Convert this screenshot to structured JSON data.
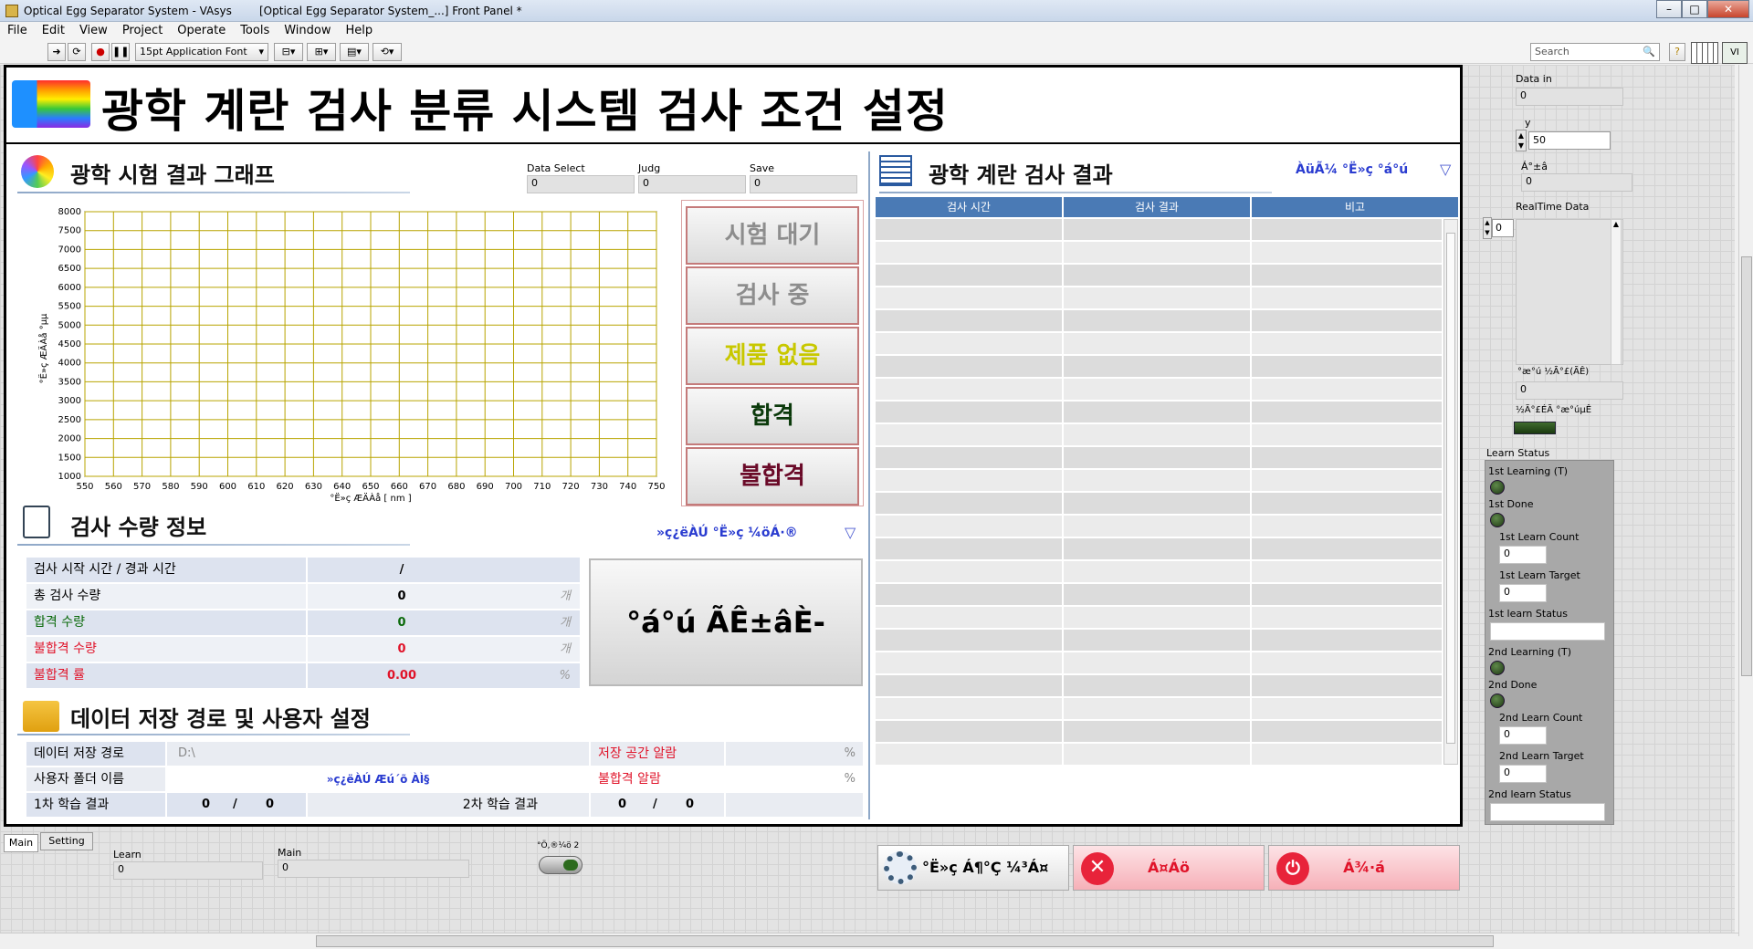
{
  "window": {
    "title": "Optical Egg Separator System - VAsys",
    "title2": "[Optical Egg Separator System_...] Front Panel *"
  },
  "menu": [
    "File",
    "Edit",
    "View",
    "Project",
    "Operate",
    "Tools",
    "Window",
    "Help"
  ],
  "toolbar": {
    "font": "15pt Application Font",
    "search_placeholder": "Search"
  },
  "panel": {
    "title": "광학 계란 검사 분류 시스템 검사 조건 설정"
  },
  "graph": {
    "header": "광학 시험 결과 그래프",
    "data_select_label": "Data Select",
    "data_select_value": "0",
    "judg_label": "Judg",
    "judg_value": "0",
    "save_label": "Save",
    "save_value": "0",
    "ylabel": "°Ë»ç ÆÄÀå °­µµ",
    "xlabel": "°Ë»ç ÆÄÀå [ nm ]"
  },
  "chart_data": {
    "type": "line",
    "x": [
      550,
      560,
      570,
      580,
      590,
      600,
      610,
      620,
      630,
      640,
      650,
      660,
      670,
      680,
      690,
      700,
      710,
      720,
      730,
      740,
      750
    ],
    "y_ticks": [
      8000,
      7500,
      7000,
      6500,
      6000,
      5500,
      5000,
      4500,
      4000,
      3500,
      3000,
      2500,
      2000,
      1500,
      1000
    ],
    "series": [],
    "xlabel": "°Ë»ç ÆÄÀå [ nm ]",
    "ylabel": "°Ë»ç ÆÄÀå °­µµ",
    "xlim": [
      550,
      750
    ],
    "ylim": [
      1000,
      8000
    ],
    "grid": true
  },
  "status_buttons": [
    {
      "label": "시험 대기",
      "color": "#8d8d8d"
    },
    {
      "label": "검사 중",
      "color": "#8d8d8d"
    },
    {
      "label": "제품 없음",
      "color": "#c8c800"
    },
    {
      "label": "합격",
      "color": "#0b3a0b"
    },
    {
      "label": "불합격",
      "color": "#6a0a28"
    }
  ],
  "qty": {
    "header": "검사 수량 정보",
    "dropdown": "»ç¿ëÀÚ °Ë»ç ¼öÁ·®",
    "rows": [
      {
        "label": "검사 시작 시간 / 경과 시간",
        "value": "/",
        "unit": "",
        "color": "#000"
      },
      {
        "label": "총 검사 수량",
        "value": "0",
        "unit": "개",
        "color": "#000"
      },
      {
        "label": "합격 수량",
        "value": "0",
        "unit": "개",
        "color": "#0b6a0b"
      },
      {
        "label": "불합격 수량",
        "value": "0",
        "unit": "개",
        "color": "#e0142a"
      },
      {
        "label": "불합격 률",
        "value": "0.00",
        "unit": "%",
        "color": "#e0142a"
      }
    ],
    "big_button": "°á°ú ÃÊ±âÈ-"
  },
  "storage": {
    "header": "데이터 저장 경로 및 사용자 설정",
    "path_label": "데이터 저장 경로",
    "path_value": "D:\\",
    "space_label": "저장 공간 알람",
    "space_unit": "%",
    "user_label": "사용자 폴더 이름",
    "user_value": "»ç¿ëÀÚ Æú´õ ÀÌ§",
    "reject_label": "불합격 알람",
    "reject_unit": "%",
    "learn1_label": "1차 학습 결과",
    "learn1_a": "0",
    "learn1_sep": "/",
    "learn1_b": "0",
    "learn2_label": "2차 학습 결과",
    "learn2_a": "0",
    "learn2_sep": "/",
    "learn2_b": "0"
  },
  "results": {
    "header": "광학 계란 검사 결과",
    "dropdown": "ÀüÃ¼ °Ë»ç °á°ú",
    "columns": [
      "검사 시간",
      "검사 결과",
      "비고"
    ],
    "btn_settings": "°Ë»ç Á¶°Ç ¼³Á¤",
    "btn_stop": "Á¤Áö",
    "btn_exit": "Á¾·á"
  },
  "tabs": [
    "Main",
    "Setting"
  ],
  "bottom": {
    "learn_label": "Learn",
    "learn_value": "0",
    "main_label": "Main",
    "main_value": "0",
    "toggle_label": "°Ö,®¼ö 2"
  },
  "side": {
    "data_in_label": "Data in",
    "data_in_value": "0",
    "y_label": "y",
    "y_value": "50",
    "a_label": "Á°±â",
    "a_value": "0",
    "rt_label": "RealTime Data",
    "rt_index": "0",
    "save_path_label": "°æ°ú ½Ã°£(ÃÊ)",
    "save_path_value": "0",
    "led_label": "½Ã°£ÉÃ °æ°úµÊ",
    "learn_status": "Learn Status",
    "first_learning": "1st Learning (T)",
    "first_done": "1st Done",
    "first_count_label": "1st Learn Count",
    "first_count": "0",
    "first_target_label": "1st Learn Target",
    "first_target": "0",
    "first_status": "1st learn Status",
    "second_learning": "2nd Learning (T)",
    "second_done": "2nd Done",
    "second_count_label": "2nd Learn Count",
    "second_count": "0",
    "second_target_label": "2nd Learn Target",
    "second_target": "0",
    "second_status": "2nd learn Status"
  }
}
